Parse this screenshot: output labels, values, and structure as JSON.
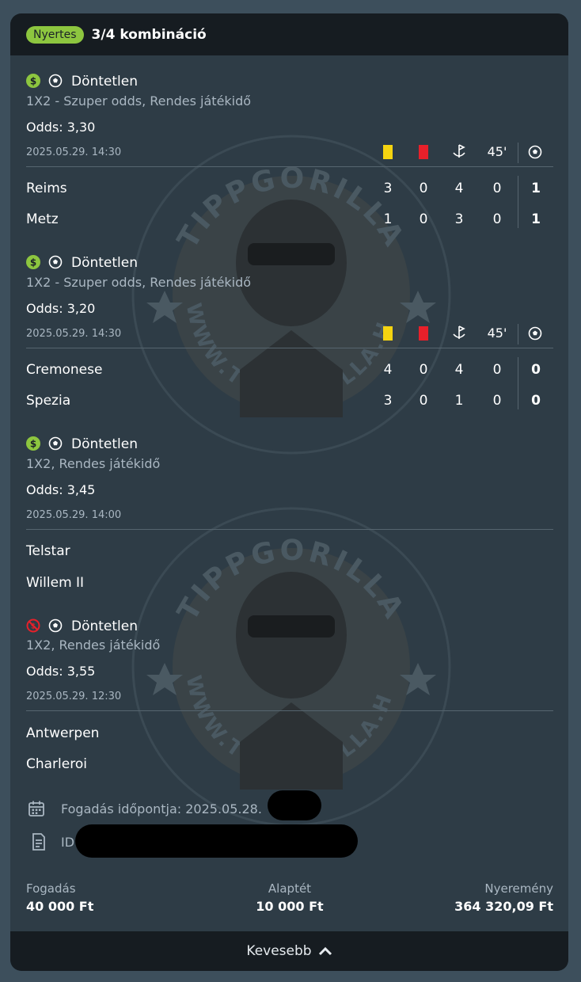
{
  "header": {
    "status": "Nyertes",
    "title": "3/4 kombináció"
  },
  "stats_headers": {
    "minute": "45'"
  },
  "bets": [
    {
      "status": "won",
      "selection": "Döntetlen",
      "market": "1X2 - Szuper odds, Rendes játékidő",
      "odds": "Odds: 3,30",
      "datetime": "2025.05.29.  14:30",
      "teams": [
        {
          "name": "Reims",
          "yellow": "3",
          "red": "0",
          "corners": "4",
          "ht": "0",
          "goals": "1"
        },
        {
          "name": "Metz",
          "yellow": "1",
          "red": "0",
          "corners": "3",
          "ht": "0",
          "goals": "1"
        }
      ]
    },
    {
      "status": "won",
      "selection": "Döntetlen",
      "market": "1X2 - Szuper odds, Rendes játékidő",
      "odds": "Odds: 3,20",
      "datetime": "2025.05.29.  14:30",
      "teams": [
        {
          "name": "Cremonese",
          "yellow": "4",
          "red": "0",
          "corners": "4",
          "ht": "0",
          "goals": "0"
        },
        {
          "name": "Spezia",
          "yellow": "3",
          "red": "0",
          "corners": "1",
          "ht": "0",
          "goals": "0"
        }
      ]
    },
    {
      "status": "won",
      "selection": "Döntetlen",
      "market": "1X2, Rendes játékidő",
      "odds": "Odds: 3,45",
      "datetime": "2025.05.29.  14:00",
      "teams": [
        {
          "name": "Telstar"
        },
        {
          "name": "Willem II"
        }
      ]
    },
    {
      "status": "lost",
      "selection": "Döntetlen",
      "market": "1X2, Rendes játékidő",
      "odds": "Odds: 3,55",
      "datetime": "2025.05.29.  12:30",
      "teams": [
        {
          "name": "Antwerpen"
        },
        {
          "name": "Charleroi"
        }
      ]
    }
  ],
  "details": {
    "placed_label": "Fogadás időpontja:",
    "placed_value": "2025.05.28.",
    "id_label": "ID"
  },
  "footer": {
    "stake_label": "Fogadás",
    "stake_value": "40 000 Ft",
    "base_label": "Alaptét",
    "base_value": "10 000 Ft",
    "win_label": "Nyeremény",
    "win_value": "364 320,09 Ft"
  },
  "toggle": {
    "label": "Kevesebb"
  },
  "watermark": {
    "top_text": "TIPPGORILLA",
    "bottom_text": "WWW.TIPPGORILLA.HU"
  },
  "colors": {
    "won": "#8dc63f",
    "lost": "#e8202a",
    "accent": "#8dc63f"
  }
}
